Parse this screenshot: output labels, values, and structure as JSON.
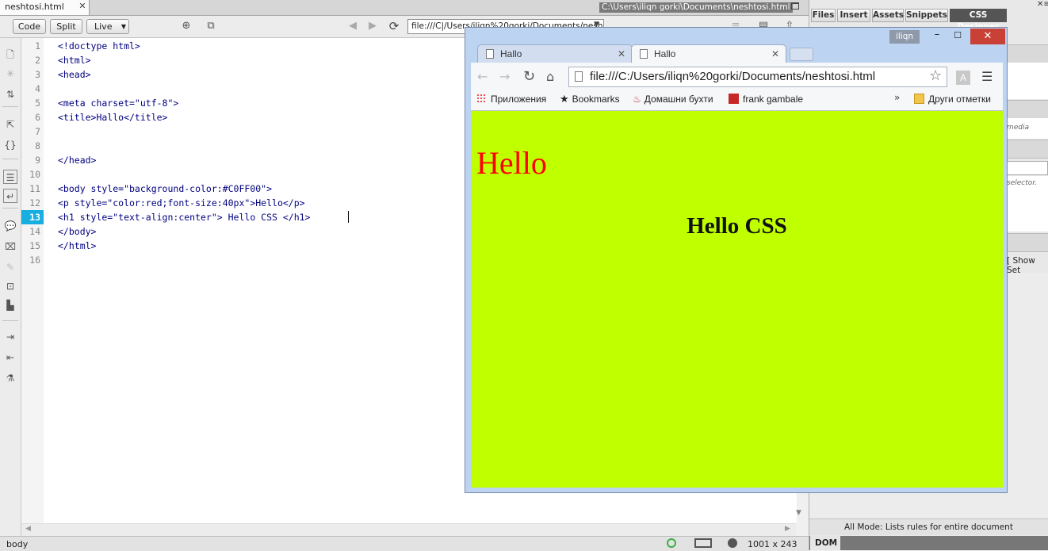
{
  "dreamweaver": {
    "doc_tab": "neshtosi.html",
    "doc_path": "C:\\Users\\iliqn gorki\\Documents\\neshtosi.html",
    "toolbar": {
      "code_label": "Code",
      "split_label": "Split",
      "live_label": "Live",
      "address": "file:///C|/Users/iliqn%20gorki/Documents/nesh"
    },
    "code": {
      "line_numbers": [
        "1",
        "2",
        "3",
        "4",
        "5",
        "6",
        "7",
        "8",
        "9",
        "10",
        "11",
        "12",
        "13",
        "14",
        "15",
        "16"
      ],
      "current_line": "13",
      "lines": [
        "<!doctype html>",
        "<html>",
        "<head>",
        "",
        "<meta charset=\"utf-8\">",
        "<title>Hallo</title>",
        "",
        "",
        "</head>",
        "",
        "<body style=\"background-color:#C0FF00\">",
        "<p style=\"color:red;font-size:40px\">Hello</p>",
        "<h1 style=\"text-align:center\"> Hello CSS </h1>",
        "</body>",
        "</html>",
        ""
      ]
    },
    "status": {
      "tag": "body",
      "size": "1001 x 243"
    }
  },
  "panel": {
    "tabs": [
      "Files",
      "Insert",
      "Assets",
      "Snippets",
      "CSS Designer"
    ],
    "active_tab": "CSS Designer",
    "hint_media": "media",
    "hint_selector": "selector.",
    "show_set_label": "Show Set",
    "mode_text": "All Mode: Lists rules for entire document",
    "dom_label": "DOM"
  },
  "chrome": {
    "user_label": "iliqn",
    "tabs": [
      {
        "title": "Hallo"
      },
      {
        "title": "Hallo"
      }
    ],
    "address": "file:///C:/Users/iliqn%20gorki/Documents/neshtosi.html",
    "extension_label": "A",
    "bookmarks": [
      "Приложения",
      "Bookmarks",
      "Домашни бухти",
      "frank gambale"
    ],
    "other_bookmarks": "Други отметки",
    "page": {
      "background": "#C0FF00",
      "paragraph": "Hello",
      "paragraph_color": "#ff0000",
      "heading": "Hello CSS"
    }
  }
}
